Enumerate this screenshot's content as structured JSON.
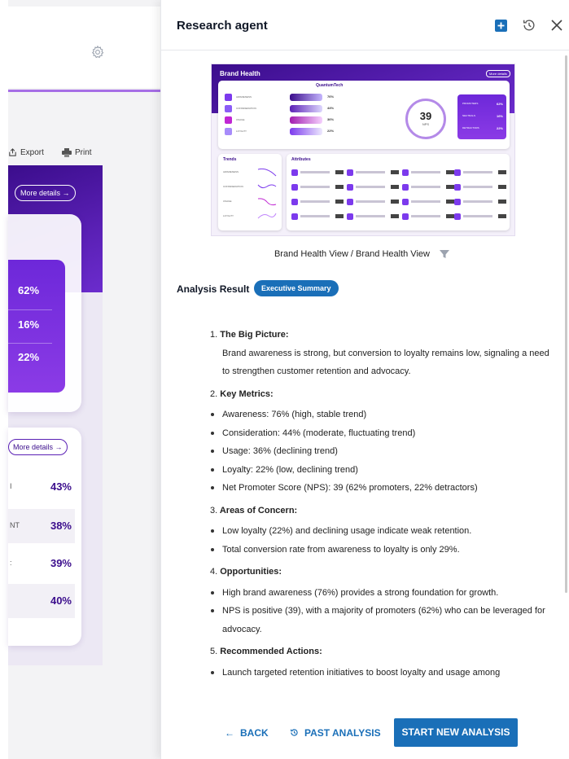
{
  "background_app": {
    "toolbar": {
      "export_label": "Export",
      "print_label": "Print"
    },
    "more_details_top": "More details",
    "nps_values": [
      "62%",
      "16%",
      "22%"
    ],
    "more_details_bottom": "More details",
    "attribute_rows": [
      {
        "label": "I",
        "value": "43%"
      },
      {
        "label": "NT",
        "value": "38%"
      },
      {
        "label": ":",
        "value": "39%"
      },
      {
        "label": "",
        "value": "40%"
      }
    ]
  },
  "panel": {
    "title": "Research agent",
    "thumbnail": {
      "title": "Brand Health",
      "more_details": "More details",
      "logo_text": "QuantumTech",
      "funnel": [
        {
          "label": "AWARENESS",
          "value": "76%",
          "color": "#7c3aed"
        },
        {
          "label": "CONSIDERATION",
          "value": "44%",
          "color": "#8b5cf6"
        },
        {
          "label": "USAGE",
          "value": "36%",
          "color": "#c026d3"
        },
        {
          "label": "LOYALTY",
          "value": "22%",
          "color": "#a78bfa"
        }
      ],
      "nps_value": "39",
      "nps_label": "NPS",
      "nps_breakdown": [
        {
          "label": "PROMOTERS",
          "value": "62%"
        },
        {
          "label": "NEUTRALS",
          "value": "16%"
        },
        {
          "label": "DETRACTORS",
          "value": "22%"
        }
      ],
      "trends_title": "Trends",
      "trends": [
        "AWARENESS",
        "CONSIDERATION",
        "USAGE",
        "LOYALTY"
      ],
      "attributes_title": "Attributes"
    },
    "caption": "Brand Health View / Brand Health View",
    "analysis_label": "Analysis Result",
    "summary_badge": "Executive Summary",
    "sections": [
      {
        "number": "1.",
        "title": "The Big Picture:",
        "body": "Brand awareness is strong, but conversion to loyalty remains low, signaling a need to strengthen customer retention and advocacy."
      },
      {
        "number": "2.",
        "title": "Key Metrics:",
        "items": [
          "Awareness: 76% (high, stable trend)",
          "Consideration: 44% (moderate, fluctuating trend)",
          "Usage: 36% (declining trend)",
          "Loyalty: 22% (low, declining trend)",
          "Net Promoter Score (NPS): 39 (62% promoters, 22% detractors)"
        ]
      },
      {
        "number": "3.",
        "title": "Areas of Concern:",
        "items": [
          "Low loyalty (22%) and declining usage indicate weak retention.",
          "Total conversion rate from awareness to loyalty is only 29%."
        ]
      },
      {
        "number": "4.",
        "title": "Opportunities:",
        "items": [
          "High brand awareness (76%) provides a strong foundation for growth.",
          "NPS is positive (39), with a majority of promoters (62%) who can be leveraged for advocacy."
        ]
      },
      {
        "number": "5.",
        "title": "Recommended Actions:",
        "items": [
          "Launch targeted retention initiatives to boost loyalty and usage among"
        ]
      }
    ],
    "footer": {
      "back_label": "BACK",
      "past_label": "PAST ANALYSIS",
      "start_label": "START NEW ANALYSIS"
    },
    "accent_color": "#1a6fb8",
    "brand_purple": "#5a20b5"
  }
}
